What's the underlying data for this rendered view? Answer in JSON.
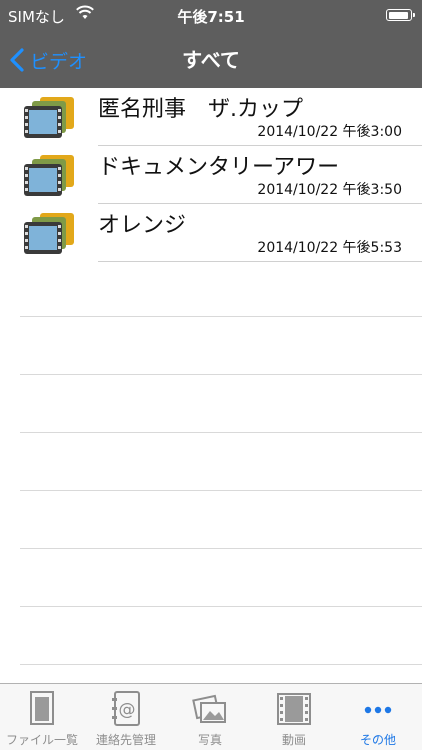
{
  "status_bar": {
    "carrier": "SIMなし",
    "time": "午後7:51",
    "wifi_icon": "wifi-icon",
    "battery_icon": "battery-icon"
  },
  "nav_bar": {
    "back_label": "ビデオ",
    "title": "すべて",
    "background_color": "#5e5e5e",
    "back_color": "#1e90ff"
  },
  "videos": [
    {
      "title": "匿名刑事　ザ.カップ",
      "date": "2014/10/22 午後3:00",
      "icon": "video-file-icon"
    },
    {
      "title": "ドキュメンタリーアワー",
      "date": "2014/10/22 午後3:50",
      "icon": "video-file-icon"
    },
    {
      "title": "オレンジ",
      "date": "2014/10/22 午後5:53",
      "icon": "video-file-icon"
    }
  ],
  "tab_bar": {
    "active_color": "#1e78e6",
    "tabs": [
      {
        "label": "ファイル一覧",
        "icon": "document-icon",
        "active": false
      },
      {
        "label": "連絡先管理",
        "icon": "address-book-icon",
        "active": false
      },
      {
        "label": "写真",
        "icon": "photos-icon",
        "active": false
      },
      {
        "label": "動画",
        "icon": "film-icon",
        "active": false
      },
      {
        "label": "その他",
        "icon": "more-icon",
        "active": true
      }
    ]
  }
}
